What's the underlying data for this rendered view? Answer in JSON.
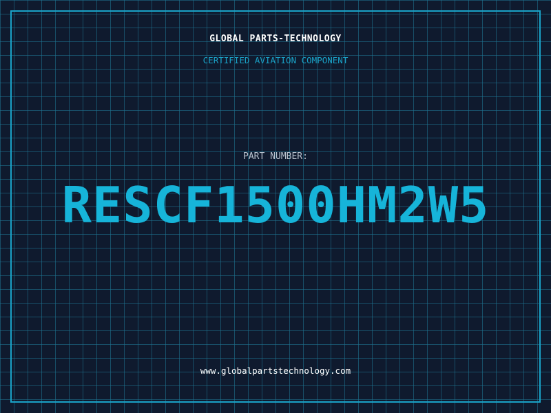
{
  "header": {
    "company": "GLOBAL PARTS-TECHNOLOGY",
    "subtitle": "CERTIFIED AVIATION COMPONENT"
  },
  "part": {
    "label": "PART NUMBER:",
    "number": "RESCF1500HM2W5"
  },
  "footer": {
    "website": "www.globalpartstechnology.com"
  },
  "colors": {
    "background": "#0f1a2e",
    "grid": "#1e7896",
    "accent": "#16b4d9",
    "frame": "#1aa3c8",
    "text": "#ffffff",
    "label": "#b9c3cf"
  }
}
